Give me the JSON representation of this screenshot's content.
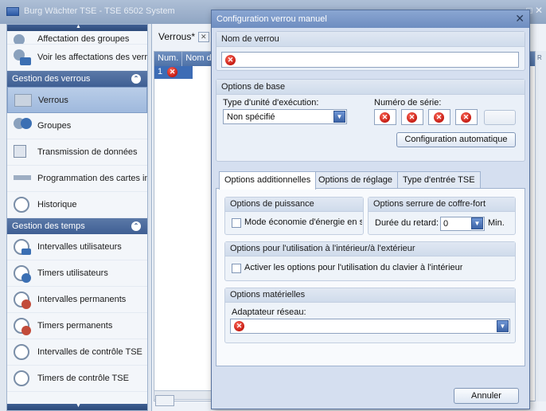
{
  "app": {
    "title": "Burg Wächter TSE - TSE 6502 System",
    "window_controls": "□ ✕"
  },
  "sidebar": {
    "top_partial": "Affectation des groupes",
    "items_top": [
      {
        "label": "Voir les affectations des verro",
        "icon": "users-icon"
      }
    ],
    "section_locks": {
      "label": "Gestion des verrous",
      "items": [
        {
          "label": "Verrous",
          "icon": "lock-icon",
          "selected": true
        },
        {
          "label": "Groupes",
          "icon": "group-icon"
        },
        {
          "label": "Transmission de données",
          "icon": "transmission-icon"
        },
        {
          "label": "Programmation des cartes in",
          "icon": "card-icon"
        },
        {
          "label": "Historique",
          "icon": "history-icon"
        }
      ]
    },
    "section_time": {
      "label": "Gestion des temps",
      "items": [
        {
          "label": "Intervalles utilisateurs",
          "icon": "clock-icon"
        },
        {
          "label": "Timers utilisateurs",
          "icon": "timer-icon"
        },
        {
          "label": "Intervalles permanents",
          "icon": "clock-icon"
        },
        {
          "label": "Timers permanents",
          "icon": "timer-icon"
        },
        {
          "label": "Intervalles de contrôle TSE",
          "icon": "clock-icon"
        },
        {
          "label": "Timers de contrôle TSE",
          "icon": "timer-icon"
        }
      ]
    }
  },
  "main": {
    "tab_label": "Verrous*",
    "grid_headers": [
      "Num.",
      "Nom de"
    ],
    "grid_rows": [
      {
        "num": "1"
      }
    ],
    "right_header": "R"
  },
  "dialog": {
    "title": "Configuration verrou manuel",
    "lock_name": {
      "heading": "Nom de verrou",
      "value": ""
    },
    "basic_options": {
      "heading": "Options de base",
      "exec_unit_label": "Type d'unité d'exécution:",
      "exec_unit_value": "Non spécifié",
      "serial_label": "Numéro de série:",
      "serial_blank_button": "",
      "auto_config_button": "Configuration automatique"
    },
    "tabs": [
      {
        "label": "Options additionnelles",
        "active": true
      },
      {
        "label": "Options de réglage",
        "active": false
      },
      {
        "label": "Type d'entrée TSE",
        "active": false
      }
    ],
    "power": {
      "heading": "Options de puissance",
      "eco_label": "Mode économie d'énergie en s",
      "eco_checked": false
    },
    "safe": {
      "heading": "Options serrure de coffre-fort",
      "delay_label": "Durée du retard:",
      "delay_value": "0",
      "delay_unit": "Min."
    },
    "indoor": {
      "heading": "Options pour l'utilisation à l'intérieur/à l'extérieur",
      "activate_label": "Activer les options pour l'utilisation du clavier à l'intérieur",
      "activate_checked": false
    },
    "hardware": {
      "heading": "Options matérielles",
      "adapter_label": "Adaptateur réseau:",
      "adapter_value": ""
    },
    "cancel_button": "Annuler"
  }
}
